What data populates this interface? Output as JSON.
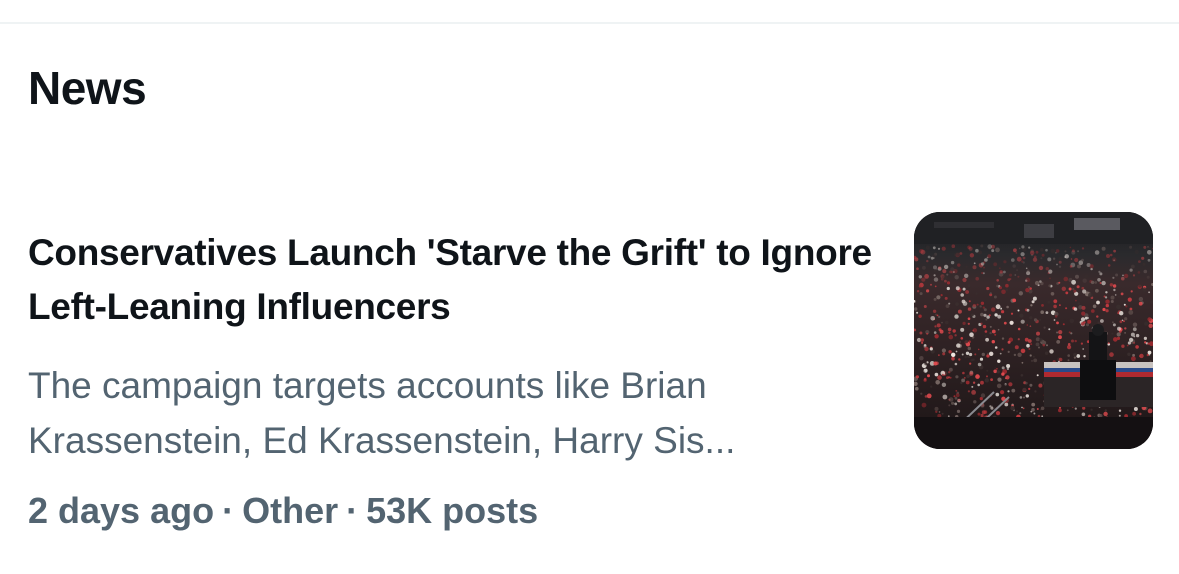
{
  "section": {
    "title": "News"
  },
  "article": {
    "headline": "Conservatives Launch 'Starve the Grift' to Ignore Left-Leaning Influencers",
    "summary": "The campaign targets accounts like Brian Krassenstein, Ed Krassenstein, Harry Sis...",
    "time_ago": "2 days ago",
    "category": "Other",
    "post_count": "53K posts",
    "separator": "·",
    "thumbnail_icon": "rally-crowd-photo"
  },
  "colors": {
    "primary_text": "#0f1419",
    "secondary_text": "#536471",
    "divider": "#eff3f4"
  }
}
